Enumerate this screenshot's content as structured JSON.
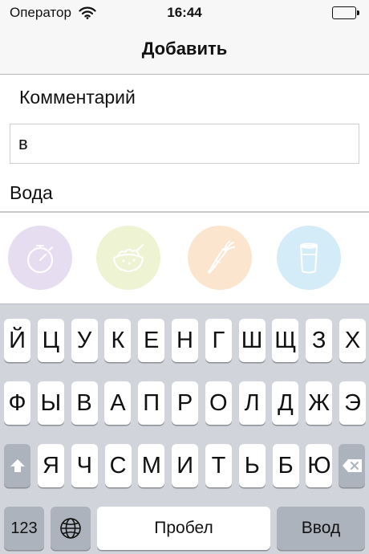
{
  "status_bar": {
    "carrier": "Оператор",
    "time": "16:44",
    "battery_level": 1.0
  },
  "nav": {
    "title": "Добавить"
  },
  "form": {
    "comment_label": "Комментарий",
    "comment_value": "в",
    "category_label": "Вода"
  },
  "categories": [
    {
      "icon": "stopwatch-icon",
      "color": "#e6def0"
    },
    {
      "icon": "salad-bowl-icon",
      "color": "#eef3d4"
    },
    {
      "icon": "carrot-icon",
      "color": "#fbe5cf"
    },
    {
      "icon": "water-glass-icon",
      "color": "#d4ecf8"
    }
  ],
  "keyboard": {
    "row1": [
      "Й",
      "Ц",
      "У",
      "К",
      "Е",
      "Н",
      "Г",
      "Ш",
      "Щ",
      "З",
      "Х"
    ],
    "row2": [
      "Ф",
      "Ы",
      "В",
      "А",
      "П",
      "Р",
      "О",
      "Л",
      "Д",
      "Ж",
      "Э"
    ],
    "row3": [
      "Я",
      "Ч",
      "С",
      "М",
      "И",
      "Т",
      "Ь",
      "Б",
      "Ю"
    ],
    "numbers_label": "123",
    "space_label": "Пробел",
    "return_label": "Ввод"
  }
}
